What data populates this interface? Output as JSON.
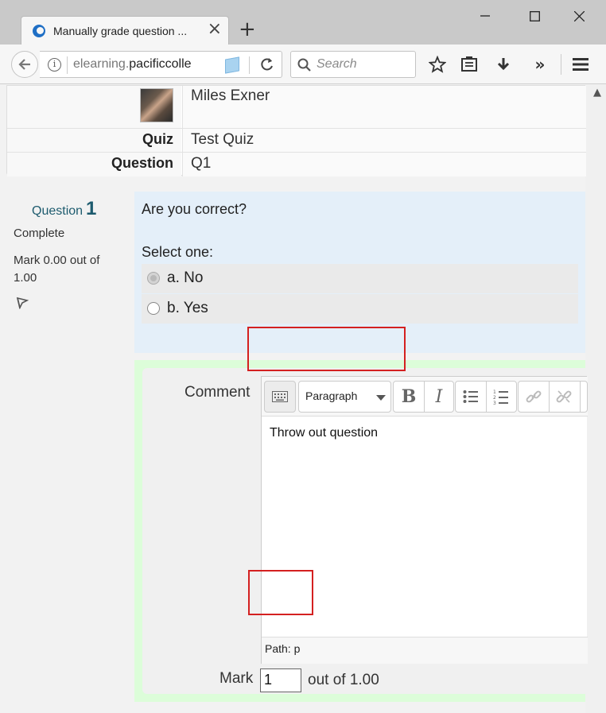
{
  "browser": {
    "tab_title": "Manually grade question ...",
    "url_domain": "elearning.",
    "url_rest": "pacificcolle",
    "search_placeholder": "Search"
  },
  "info": {
    "student_name": "Miles Exner",
    "quiz_label": "Quiz",
    "quiz_value": "Test Quiz",
    "question_label": "Question",
    "question_value": "Q1"
  },
  "question": {
    "label": "Question",
    "number": "1",
    "state": "Complete",
    "grade": "Mark 0.00 out of 1.00",
    "text": "Are you correct?",
    "prompt": "Select one:",
    "options": [
      {
        "label": "a. No",
        "selected": true
      },
      {
        "label": "b. Yes",
        "selected": false
      }
    ]
  },
  "grading": {
    "comment_label": "Comment",
    "paragraph_format": "Paragraph",
    "comment_text": "Throw out question",
    "path": "Path: p",
    "mark_label": "Mark",
    "mark_value": "1",
    "mark_suffix": "out of 1.00"
  },
  "colors": {
    "question_bg": "#e4eff9",
    "comment_bg": "#dcfdd9",
    "annotation": "#d42020",
    "question_number": "#1d5b6e"
  }
}
